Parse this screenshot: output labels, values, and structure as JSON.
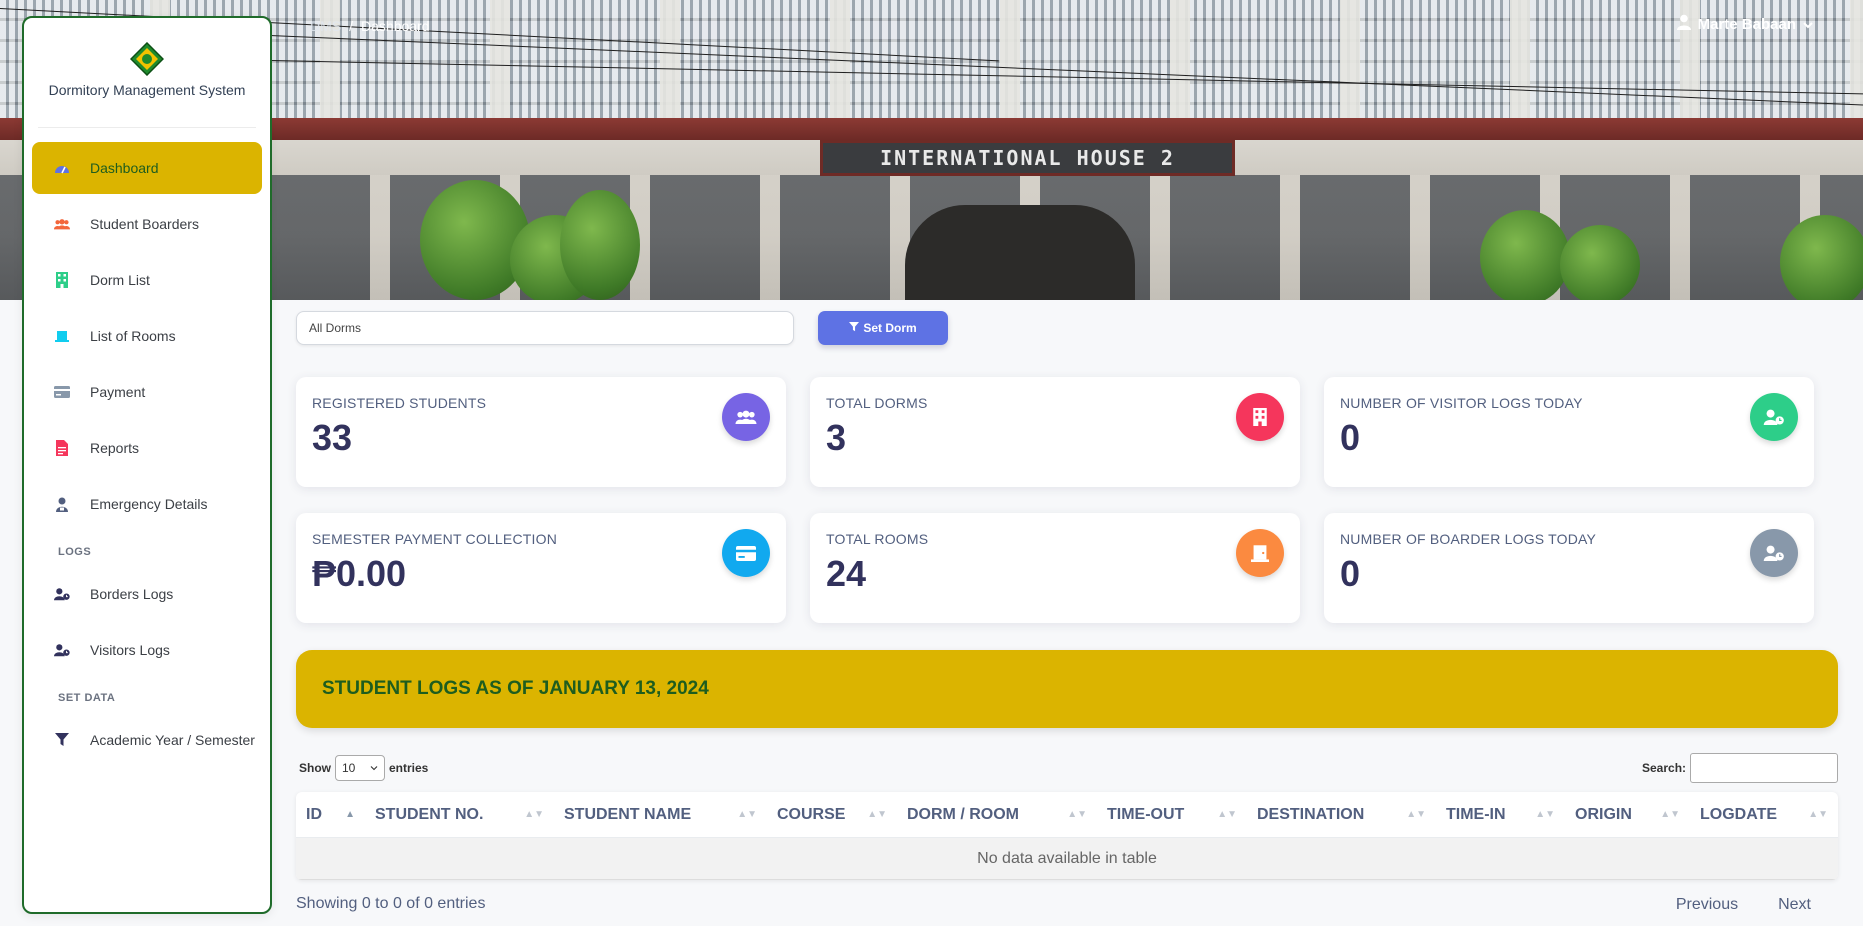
{
  "breadcrumb": {
    "root": "DMS",
    "separator": "/",
    "current": "Dashboard"
  },
  "user": {
    "name": "Marte Babaan"
  },
  "hero": {
    "sign_text": "INTERNATIONAL HOUSE 2"
  },
  "brand": {
    "title": "Dormitory Management System"
  },
  "sidebar": {
    "items": [
      {
        "label": "Dashboard",
        "icon": "dashboard-icon",
        "active": true
      },
      {
        "label": "Student Boarders",
        "icon": "users-icon"
      },
      {
        "label": "Dorm List",
        "icon": "building-icon"
      },
      {
        "label": "List of Rooms",
        "icon": "room-icon"
      },
      {
        "label": "Payment",
        "icon": "credit-card-icon"
      },
      {
        "label": "Reports",
        "icon": "file-pdf-icon"
      },
      {
        "label": "Emergency Details",
        "icon": "user-badge-icon"
      }
    ],
    "logs_section": "LOGS",
    "logs_items": [
      {
        "label": "Borders Logs",
        "icon": "user-clock-icon"
      },
      {
        "label": "Visitors Logs",
        "icon": "user-clock-icon"
      }
    ],
    "set_data_section": "SET DATA",
    "set_data_items": [
      {
        "label": "Academic Year / Semester",
        "icon": "filter-icon"
      }
    ]
  },
  "filter": {
    "selected": "All Dorms",
    "button_label": "Set Dorm"
  },
  "stats": [
    {
      "label": "REGISTERED STUDENTS",
      "value": "33",
      "icon": "users-icon",
      "color": "#7764e4"
    },
    {
      "label": "TOTAL DORMS",
      "value": "3",
      "icon": "building-icon",
      "color": "#f5365c"
    },
    {
      "label": "NUMBER OF VISITOR LOGS TODAY",
      "value": "0",
      "icon": "user-clock-icon",
      "color": "#2dce89"
    },
    {
      "label": "SEMESTER PAYMENT COLLECTION",
      "value": "₱0.00",
      "icon": "credit-card-icon",
      "color": "#11a9ef"
    },
    {
      "label": "TOTAL ROOMS",
      "value": "24",
      "icon": "door-icon",
      "color": "#fb8a40"
    },
    {
      "label": "NUMBER OF BOARDER LOGS TODAY",
      "value": "0",
      "icon": "user-clock-icon",
      "color": "#8898aa"
    }
  ],
  "logs": {
    "title": "STUDENT LOGS AS OF JANUARY 13, 2024"
  },
  "table": {
    "show_label": "Show",
    "length_value": "10",
    "entries_label": "entries",
    "search_label": "Search:",
    "search_value": "",
    "columns": [
      "ID",
      "STUDENT NO.",
      "STUDENT NAME",
      "COURSE",
      "DORM / ROOM",
      "TIME-OUT",
      "DESTINATION",
      "TIME-IN",
      "ORIGIN",
      "LOGDATE"
    ],
    "empty_message": "No data available in table",
    "info": "Showing 0 to 0 of 0 entries",
    "previous_label": "Previous",
    "next_label": "Next"
  }
}
